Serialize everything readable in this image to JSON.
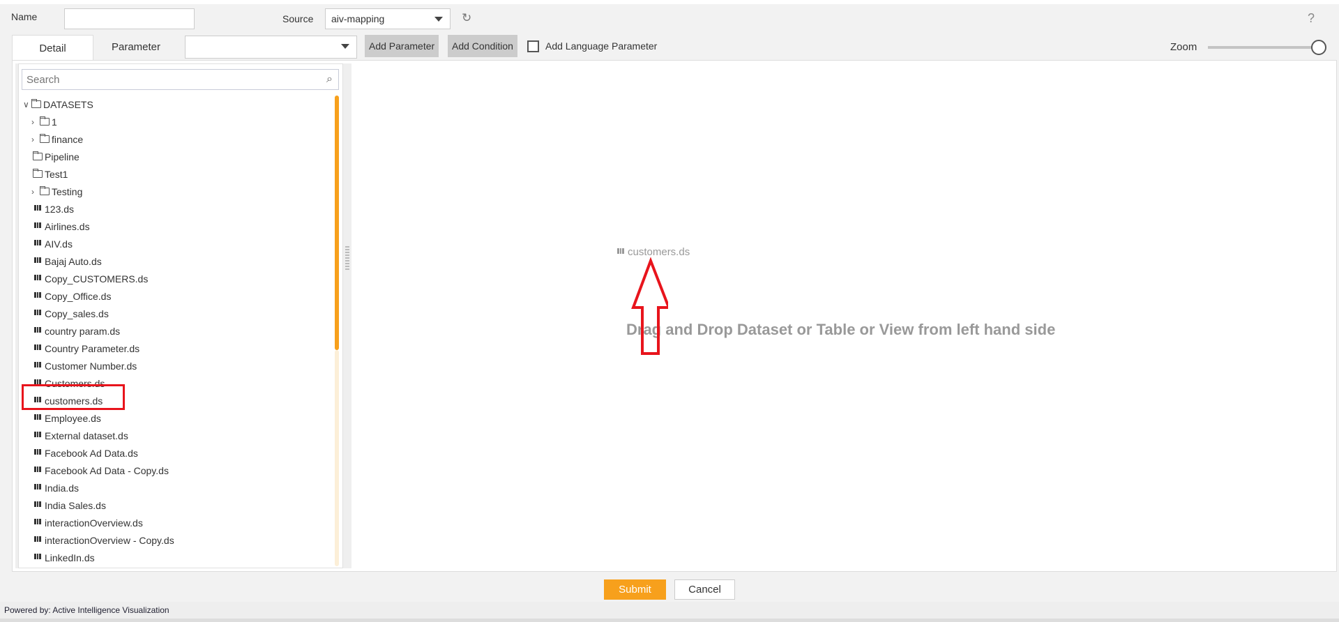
{
  "header": {
    "name_label": "Name",
    "name_value": "",
    "source_label": "Source",
    "source_value": "aiv-mapping",
    "help": "?"
  },
  "tabs": [
    {
      "label": "Detail",
      "active": true
    },
    {
      "label": "Parameter",
      "active": false
    }
  ],
  "toolbar": {
    "parameter_select": "",
    "add_parameter": "Add Parameter",
    "add_condition": "Add Condition",
    "add_language_label": "Add Language Parameter",
    "add_language_checked": false,
    "zoom_label": "Zoom",
    "zoom_level": 1.0
  },
  "tree": {
    "search_placeholder": "Search",
    "root": "DATASETS",
    "items": [
      {
        "label": "1",
        "type": "folder",
        "expandable": true
      },
      {
        "label": "finance",
        "type": "folder",
        "expandable": true
      },
      {
        "label": "Pipeline",
        "type": "folder",
        "expandable": false
      },
      {
        "label": "Test1",
        "type": "folder",
        "expandable": false
      },
      {
        "label": "Testing",
        "type": "folder",
        "expandable": true
      },
      {
        "label": "123.ds",
        "type": "ds"
      },
      {
        "label": "Airlines.ds",
        "type": "ds"
      },
      {
        "label": "AIV.ds",
        "type": "ds"
      },
      {
        "label": "Bajaj Auto.ds",
        "type": "ds"
      },
      {
        "label": "Copy_CUSTOMERS.ds",
        "type": "ds"
      },
      {
        "label": "Copy_Office.ds",
        "type": "ds"
      },
      {
        "label": "Copy_sales.ds",
        "type": "ds"
      },
      {
        "label": "country param.ds",
        "type": "ds"
      },
      {
        "label": "Country Parameter.ds",
        "type": "ds"
      },
      {
        "label": "Customer Number.ds",
        "type": "ds"
      },
      {
        "label": "Customers.ds",
        "type": "ds"
      },
      {
        "label": "customers.ds",
        "type": "ds",
        "highlighted": true
      },
      {
        "label": "Employee.ds",
        "type": "ds"
      },
      {
        "label": "External dataset.ds",
        "type": "ds"
      },
      {
        "label": "Facebook Ad Data.ds",
        "type": "ds"
      },
      {
        "label": "Facebook Ad Data - Copy.ds",
        "type": "ds"
      },
      {
        "label": "India.ds",
        "type": "ds"
      },
      {
        "label": "India Sales.ds",
        "type": "ds"
      },
      {
        "label": "interactionOverview.ds",
        "type": "ds"
      },
      {
        "label": "interactionOverview - Copy.ds",
        "type": "ds"
      },
      {
        "label": "LinkedIn.ds",
        "type": "ds"
      }
    ]
  },
  "canvas": {
    "dropped_item": "customers.ds",
    "hint": "Drag and Drop Dataset or Table or View from left hand side"
  },
  "footer": {
    "submit": "Submit",
    "cancel": "Cancel",
    "powered_by": "Powered by: Active Intelligence Visualization"
  },
  "colors": {
    "accent": "#f7a01c",
    "highlight": "#e8141c"
  }
}
